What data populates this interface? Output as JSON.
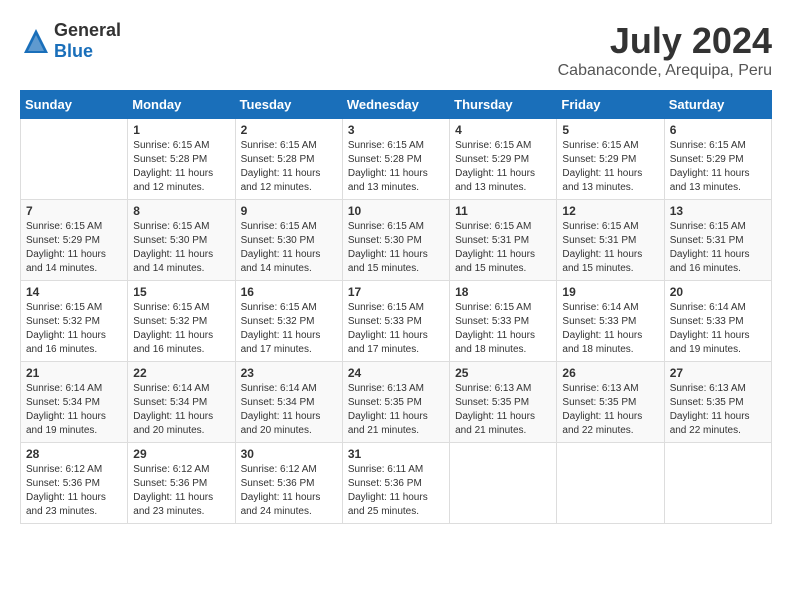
{
  "header": {
    "logo_general": "General",
    "logo_blue": "Blue",
    "title": "July 2024",
    "location": "Cabanaconde, Arequipa, Peru"
  },
  "calendar": {
    "weekdays": [
      "Sunday",
      "Monday",
      "Tuesday",
      "Wednesday",
      "Thursday",
      "Friday",
      "Saturday"
    ],
    "weeks": [
      [
        {
          "day": "",
          "info": ""
        },
        {
          "day": "1",
          "info": "Sunrise: 6:15 AM\nSunset: 5:28 PM\nDaylight: 11 hours\nand 12 minutes."
        },
        {
          "day": "2",
          "info": "Sunrise: 6:15 AM\nSunset: 5:28 PM\nDaylight: 11 hours\nand 12 minutes."
        },
        {
          "day": "3",
          "info": "Sunrise: 6:15 AM\nSunset: 5:28 PM\nDaylight: 11 hours\nand 13 minutes."
        },
        {
          "day": "4",
          "info": "Sunrise: 6:15 AM\nSunset: 5:29 PM\nDaylight: 11 hours\nand 13 minutes."
        },
        {
          "day": "5",
          "info": "Sunrise: 6:15 AM\nSunset: 5:29 PM\nDaylight: 11 hours\nand 13 minutes."
        },
        {
          "day": "6",
          "info": "Sunrise: 6:15 AM\nSunset: 5:29 PM\nDaylight: 11 hours\nand 13 minutes."
        }
      ],
      [
        {
          "day": "7",
          "info": "Sunrise: 6:15 AM\nSunset: 5:29 PM\nDaylight: 11 hours\nand 14 minutes."
        },
        {
          "day": "8",
          "info": "Sunrise: 6:15 AM\nSunset: 5:30 PM\nDaylight: 11 hours\nand 14 minutes."
        },
        {
          "day": "9",
          "info": "Sunrise: 6:15 AM\nSunset: 5:30 PM\nDaylight: 11 hours\nand 14 minutes."
        },
        {
          "day": "10",
          "info": "Sunrise: 6:15 AM\nSunset: 5:30 PM\nDaylight: 11 hours\nand 15 minutes."
        },
        {
          "day": "11",
          "info": "Sunrise: 6:15 AM\nSunset: 5:31 PM\nDaylight: 11 hours\nand 15 minutes."
        },
        {
          "day": "12",
          "info": "Sunrise: 6:15 AM\nSunset: 5:31 PM\nDaylight: 11 hours\nand 15 minutes."
        },
        {
          "day": "13",
          "info": "Sunrise: 6:15 AM\nSunset: 5:31 PM\nDaylight: 11 hours\nand 16 minutes."
        }
      ],
      [
        {
          "day": "14",
          "info": "Sunrise: 6:15 AM\nSunset: 5:32 PM\nDaylight: 11 hours\nand 16 minutes."
        },
        {
          "day": "15",
          "info": "Sunrise: 6:15 AM\nSunset: 5:32 PM\nDaylight: 11 hours\nand 16 minutes."
        },
        {
          "day": "16",
          "info": "Sunrise: 6:15 AM\nSunset: 5:32 PM\nDaylight: 11 hours\nand 17 minutes."
        },
        {
          "day": "17",
          "info": "Sunrise: 6:15 AM\nSunset: 5:33 PM\nDaylight: 11 hours\nand 17 minutes."
        },
        {
          "day": "18",
          "info": "Sunrise: 6:15 AM\nSunset: 5:33 PM\nDaylight: 11 hours\nand 18 minutes."
        },
        {
          "day": "19",
          "info": "Sunrise: 6:14 AM\nSunset: 5:33 PM\nDaylight: 11 hours\nand 18 minutes."
        },
        {
          "day": "20",
          "info": "Sunrise: 6:14 AM\nSunset: 5:33 PM\nDaylight: 11 hours\nand 19 minutes."
        }
      ],
      [
        {
          "day": "21",
          "info": "Sunrise: 6:14 AM\nSunset: 5:34 PM\nDaylight: 11 hours\nand 19 minutes."
        },
        {
          "day": "22",
          "info": "Sunrise: 6:14 AM\nSunset: 5:34 PM\nDaylight: 11 hours\nand 20 minutes."
        },
        {
          "day": "23",
          "info": "Sunrise: 6:14 AM\nSunset: 5:34 PM\nDaylight: 11 hours\nand 20 minutes."
        },
        {
          "day": "24",
          "info": "Sunrise: 6:13 AM\nSunset: 5:35 PM\nDaylight: 11 hours\nand 21 minutes."
        },
        {
          "day": "25",
          "info": "Sunrise: 6:13 AM\nSunset: 5:35 PM\nDaylight: 11 hours\nand 21 minutes."
        },
        {
          "day": "26",
          "info": "Sunrise: 6:13 AM\nSunset: 5:35 PM\nDaylight: 11 hours\nand 22 minutes."
        },
        {
          "day": "27",
          "info": "Sunrise: 6:13 AM\nSunset: 5:35 PM\nDaylight: 11 hours\nand 22 minutes."
        }
      ],
      [
        {
          "day": "28",
          "info": "Sunrise: 6:12 AM\nSunset: 5:36 PM\nDaylight: 11 hours\nand 23 minutes."
        },
        {
          "day": "29",
          "info": "Sunrise: 6:12 AM\nSunset: 5:36 PM\nDaylight: 11 hours\nand 23 minutes."
        },
        {
          "day": "30",
          "info": "Sunrise: 6:12 AM\nSunset: 5:36 PM\nDaylight: 11 hours\nand 24 minutes."
        },
        {
          "day": "31",
          "info": "Sunrise: 6:11 AM\nSunset: 5:36 PM\nDaylight: 11 hours\nand 25 minutes."
        },
        {
          "day": "",
          "info": ""
        },
        {
          "day": "",
          "info": ""
        },
        {
          "day": "",
          "info": ""
        }
      ]
    ]
  }
}
